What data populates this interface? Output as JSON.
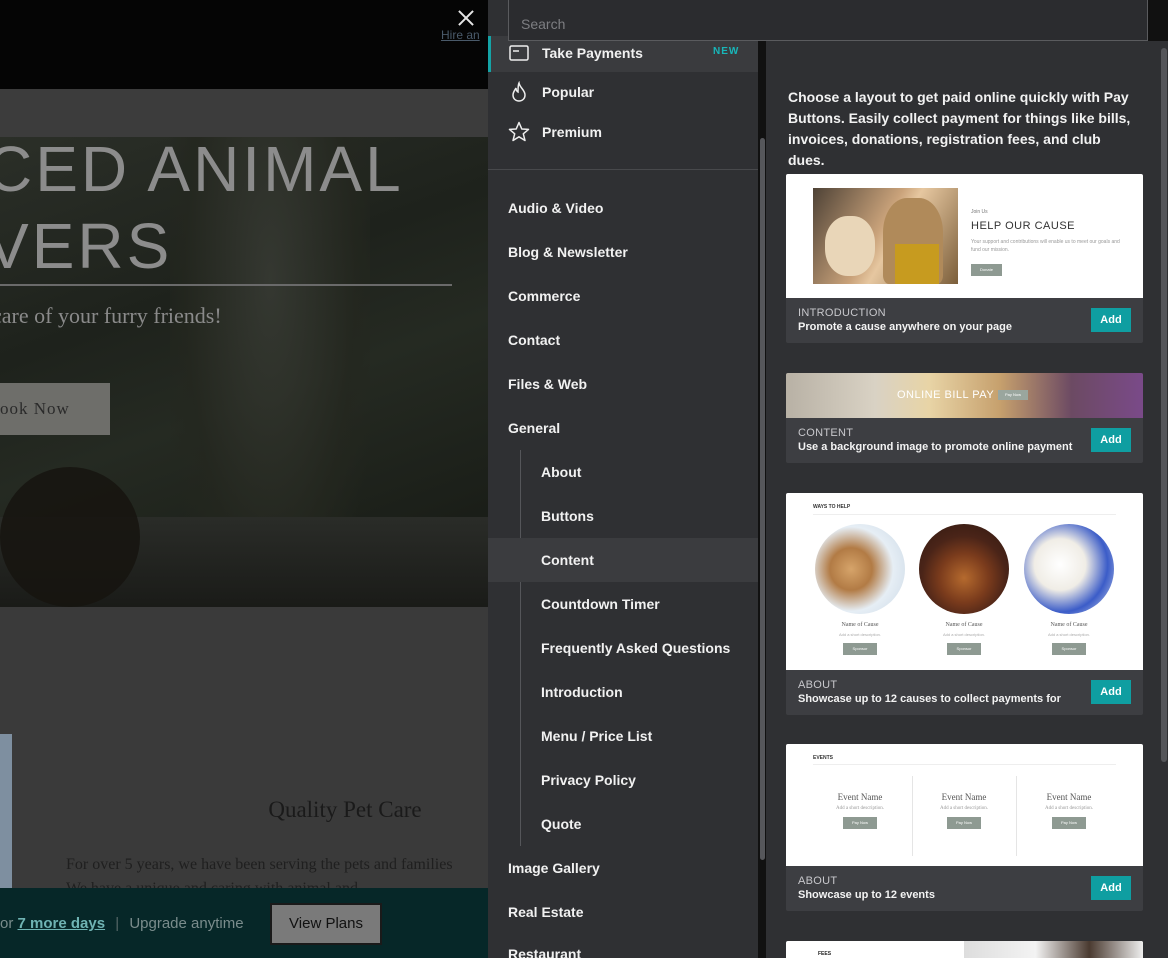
{
  "background_site": {
    "hire_link": "Hire an",
    "hero_title_line1": "CED ANIMAL",
    "hero_title_line2": "VERS",
    "hero_subtitle": "care of your furry friends!",
    "hero_button": "ook Now",
    "section_title": "Quality Pet Care",
    "section_para_line1": "For over 5 years, we have been serving the pets and families",
    "section_para_line2": "We have a unique and caring with animal and",
    "trial": {
      "prefix": "or",
      "link": "7 more days",
      "separator": "|",
      "suffix": "Upgrade anytime",
      "button": "View Plans"
    }
  },
  "search": {
    "placeholder": "Search"
  },
  "sidebar": {
    "featured": [
      {
        "label": "Take Payments",
        "icon": "card-icon",
        "badge": "NEW"
      },
      {
        "label": "Popular",
        "icon": "flame-icon"
      },
      {
        "label": "Premium",
        "icon": "star-icon"
      }
    ],
    "categories": {
      "audio_video": "Audio & Video",
      "blog": "Blog & Newsletter",
      "commerce": "Commerce",
      "contact": "Contact",
      "files_web": "Files & Web",
      "general": "General",
      "image_gallery": "Image Gallery",
      "real_estate": "Real Estate",
      "restaurant": "Restaurant"
    },
    "general_sub": {
      "about": "About",
      "buttons": "Buttons",
      "content": "Content",
      "countdown": "Countdown Timer",
      "faq": "Frequently Asked Questions",
      "introduction": "Introduction",
      "menu": "Menu / Price List",
      "privacy": "Privacy Policy",
      "quote": "Quote"
    }
  },
  "panel": {
    "intro": "Choose a layout to get paid online quickly with Pay Buttons. Easily collect payment for things like bills, invoices, donations, registration fees, and club dues.",
    "add_label": "Add",
    "cards": [
      {
        "category": "INTRODUCTION",
        "description": "Promote a cause anywhere on your page",
        "preview": {
          "small": "Join Us",
          "title": "HELP OUR CAUSE",
          "body": "Your support and contributions will enable us to meet our goals and fund our mission.",
          "button": "Donate"
        }
      },
      {
        "category": "CONTENT",
        "description": "Use a background image to promote online payment",
        "preview": {
          "title": "ONLINE BILL PAY",
          "button": "Pay Now"
        }
      },
      {
        "category": "ABOUT",
        "description": "Showcase up to 12 causes to collect payments for",
        "preview": {
          "heading": "WAYS TO HELP",
          "name": "Name of Cause",
          "desc": "Add a short description.",
          "button": "Sponsor"
        }
      },
      {
        "category": "ABOUT",
        "description": "Showcase up to 12 events",
        "preview": {
          "heading": "EVENTS",
          "name": "Event Name",
          "desc": "Add a short description.",
          "button": "Pay Now"
        }
      },
      {
        "preview": {
          "heading": "FEES"
        }
      }
    ]
  },
  "colors": {
    "accent": "#14a3a6",
    "sidebar_bg": "#2f3033",
    "add_button": "#0f9ea1"
  }
}
